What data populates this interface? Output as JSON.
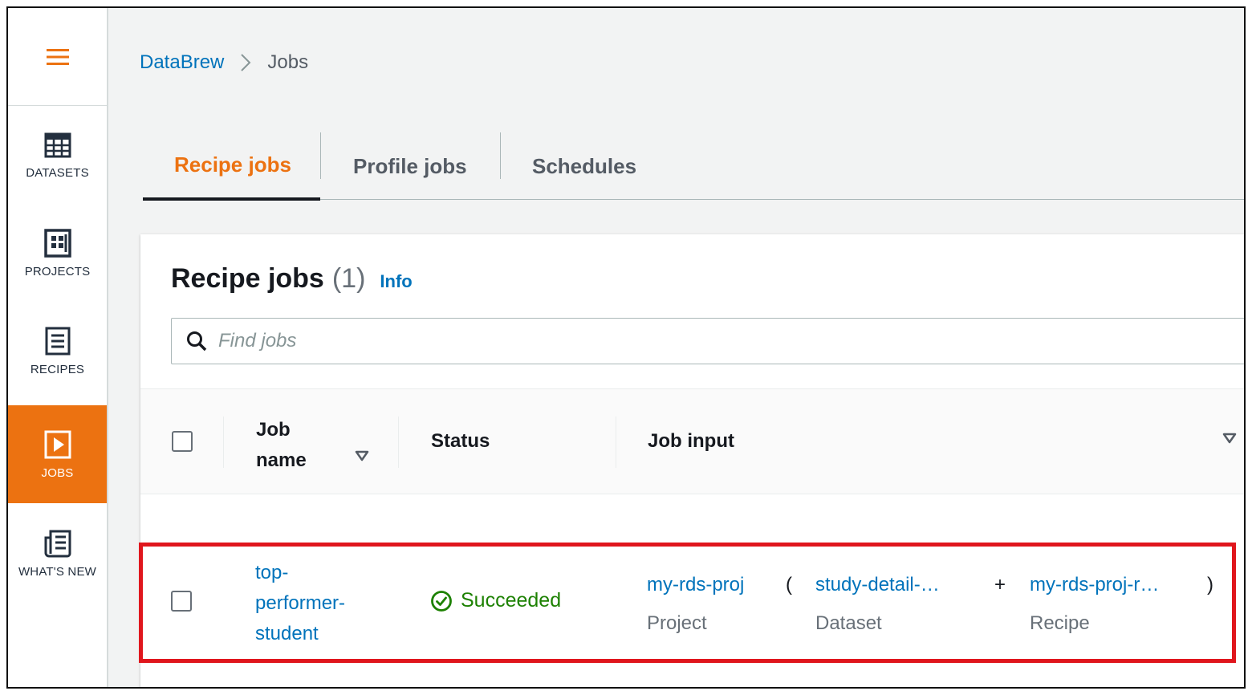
{
  "sidebar": {
    "items": [
      {
        "label": "DATASETS",
        "icon": "table-grid-icon",
        "active": false
      },
      {
        "label": "PROJECTS",
        "icon": "projects-grid-icon",
        "active": false
      },
      {
        "label": "RECIPES",
        "icon": "recipe-list-icon",
        "active": false
      },
      {
        "label": "JOBS",
        "icon": "play-icon",
        "active": true
      },
      {
        "label": "WHAT'S NEW",
        "icon": "newspaper-icon",
        "active": false
      }
    ]
  },
  "breadcrumb": {
    "root": "DataBrew",
    "current": "Jobs"
  },
  "tabs": [
    {
      "label": "Recipe jobs",
      "active": true
    },
    {
      "label": "Profile jobs",
      "active": false
    },
    {
      "label": "Schedules",
      "active": false
    }
  ],
  "panel": {
    "title": "Recipe jobs",
    "count": "(1)",
    "info": "Info"
  },
  "search": {
    "placeholder": "Find jobs"
  },
  "table": {
    "columns": {
      "job_name_line1": "Job",
      "job_name_line2": "name",
      "status": "Status",
      "job_input": "Job input"
    },
    "rows": [
      {
        "job_name_lines": [
          "top-",
          "performer-",
          "student"
        ],
        "status": "Succeeded",
        "project": "my-rds-proj",
        "project_label": "Project",
        "open_paren": "(",
        "dataset": "study-detail-…",
        "dataset_label": "Dataset",
        "plus": "+",
        "recipe": "my-rds-proj-r…",
        "recipe_label": "Recipe",
        "close_paren": ")"
      }
    ]
  },
  "colors": {
    "accent": "#ec7211",
    "link": "#0073bb",
    "success": "#1d8102",
    "highlight": "#e0161d"
  }
}
